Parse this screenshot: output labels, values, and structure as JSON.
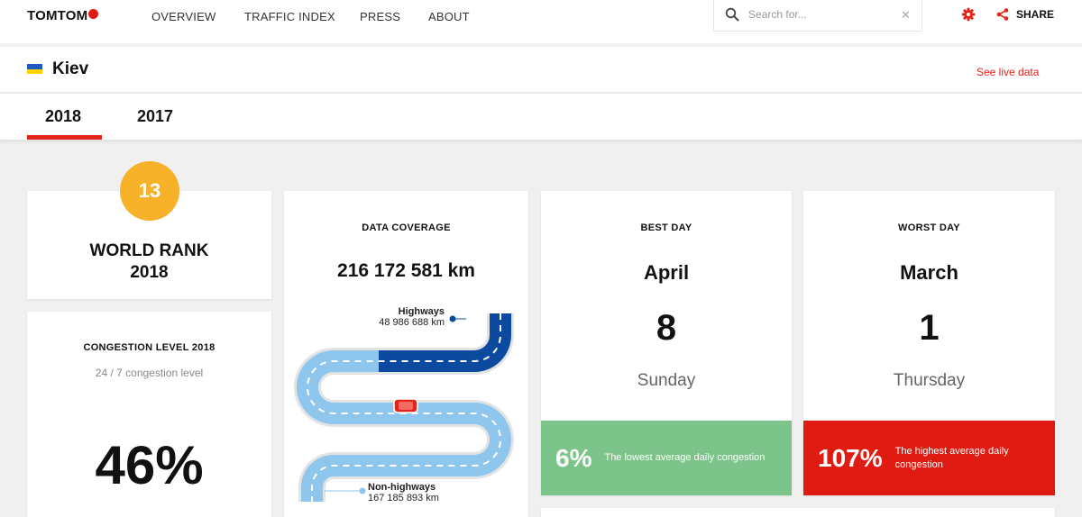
{
  "nav": {
    "logo": "TOMTOM",
    "items": [
      "OVERVIEW",
      "TRAFFIC INDEX",
      "PRESS",
      "ABOUT"
    ],
    "search_placeholder": "Search for...",
    "share_label": "SHARE"
  },
  "city": {
    "name": "Kiev",
    "live_link": "See live data"
  },
  "tabs": [
    "2018",
    "2017"
  ],
  "rank": {
    "value": "13",
    "title": "WORLD RANK",
    "year": "2018"
  },
  "congestion": {
    "title": "CONGESTION LEVEL 2018",
    "subtitle": "24 / 7 congestion level",
    "value": "46%"
  },
  "coverage": {
    "title": "DATA COVERAGE",
    "total": "216 172 581 km",
    "highways_label": "Highways",
    "highways_value": "48 986 688 km",
    "nonhighways_label": "Non-highways",
    "nonhighways_value": "167 185 893 km"
  },
  "best_day": {
    "title": "BEST DAY",
    "month": "April",
    "day": "8",
    "weekday": "Sunday",
    "pct": "6%",
    "desc": "The lowest average daily congestion",
    "color": "#7dc48a"
  },
  "worst_day": {
    "title": "WORST DAY",
    "month": "March",
    "day": "1",
    "weekday": "Thursday",
    "pct": "107%",
    "desc": "The highest average daily congestion",
    "color": "#df1b12"
  },
  "colors": {
    "accent": "#e3241b",
    "rank_badge": "#f8b229",
    "highway": "#0b4a9e",
    "nonhighway": "#8ec6ee"
  }
}
